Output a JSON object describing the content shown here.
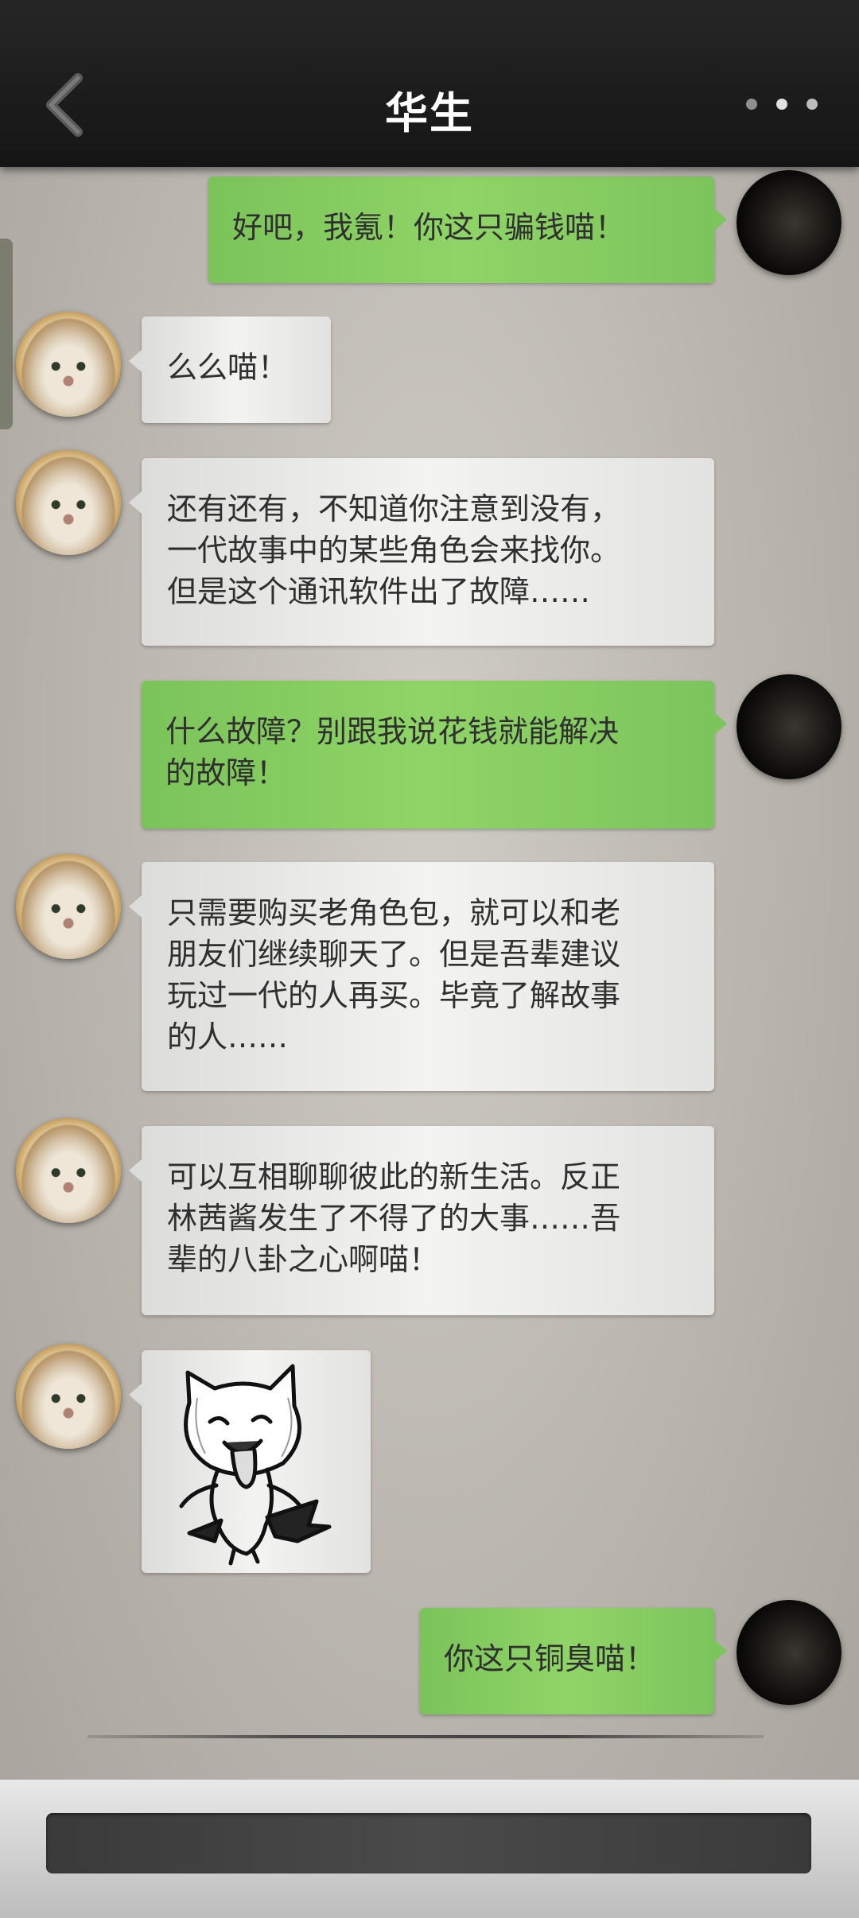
{
  "header": {
    "title": "华生",
    "back_icon": "chevron-left-icon",
    "more_icon": "more-dots-icon"
  },
  "messages": [
    {
      "side": "right",
      "avatar": "dark-avatar",
      "text": "好吧，我氪！你这只骗钱喵！"
    },
    {
      "side": "left",
      "avatar": "cat-avatar",
      "text": "么么喵！"
    },
    {
      "side": "left",
      "avatar": "cat-avatar",
      "text": "还有还有，不知道你注意到没有，\n一代故事中的某些角色会来找你。\n但是这个通讯软件出了故障……"
    },
    {
      "side": "right",
      "avatar": "dark-avatar",
      "text": "什么故障？别跟我说花钱就能解决\n的故障！"
    },
    {
      "side": "left",
      "avatar": "cat-avatar",
      "text": "只需要购买老角色包，就可以和老\n朋友们继续聊天了。但是吾辈建议\n玩过一代的人再买。毕竟了解故事\n的人……"
    },
    {
      "side": "left",
      "avatar": "cat-avatar",
      "text": "可以互相聊聊彼此的新生活。反正\n林茜酱发生了不得了的大事……吾\n辈的八卦之心啊喵！"
    },
    {
      "side": "left",
      "avatar": "cat-avatar",
      "type": "sticker",
      "sticker": "cartoon-cat-sticker"
    },
    {
      "side": "right",
      "avatar": "dark-avatar",
      "text": "你这只铜臭喵！"
    }
  ],
  "composer": {
    "input_value": "",
    "placeholder": ""
  },
  "colors": {
    "topbar": "#1b1b1b",
    "bubble_right": "#86cc60",
    "bubble_left": "#ececea",
    "background": "#bebab3"
  }
}
